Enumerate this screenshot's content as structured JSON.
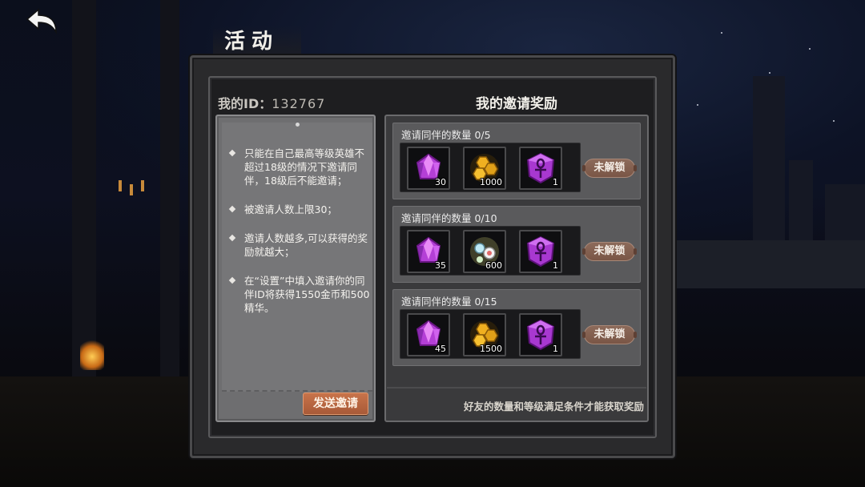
{
  "header": {
    "title": "活动",
    "back_icon": "back-arrow-icon"
  },
  "profile": {
    "id_label": "我的ID：",
    "id_value": "132767"
  },
  "rules": [
    "只能在自己最高等级英雄不超过18级的情况下邀请同伴，18级后不能邀请；",
    "被邀请人数上限30；",
    "邀请人数越多,可以获得的奖励就越大；",
    "在“设置”中填入邀请你的同伴ID将获得1550金币和500精华。"
  ],
  "send_button": "发送邀请",
  "rewards": {
    "title": "我的邀请奖励",
    "footer": "好友的数量和等级满足条件才能获取奖励",
    "tiers": [
      {
        "label": "邀请同伴的数量 0/5",
        "button": "未解锁",
        "items": [
          {
            "icon": "purple-gem-icon",
            "qty": "30"
          },
          {
            "icon": "gold-hexagon-coins-icon",
            "qty": "1000"
          },
          {
            "icon": "purple-ankh-shield-icon",
            "qty": "1"
          }
        ]
      },
      {
        "label": "邀请同伴的数量 0/10",
        "button": "未解锁",
        "items": [
          {
            "icon": "purple-gem-icon",
            "qty": "35"
          },
          {
            "icon": "essence-orbs-icon",
            "qty": "600"
          },
          {
            "icon": "purple-ankh-shield-icon",
            "qty": "1"
          }
        ]
      },
      {
        "label": "邀请同伴的数量 0/15",
        "button": "未解锁",
        "items": [
          {
            "icon": "purple-gem-icon",
            "qty": "45"
          },
          {
            "icon": "gold-hexagon-coins-icon",
            "qty": "1500"
          },
          {
            "icon": "purple-ankh-shield-icon",
            "qty": "1"
          }
        ]
      }
    ]
  },
  "colors": {
    "accent_button": "#b8643f",
    "locked_button": "#84604f",
    "gem_purple": "#c44ee0",
    "coin_gold": "#e8a820"
  }
}
